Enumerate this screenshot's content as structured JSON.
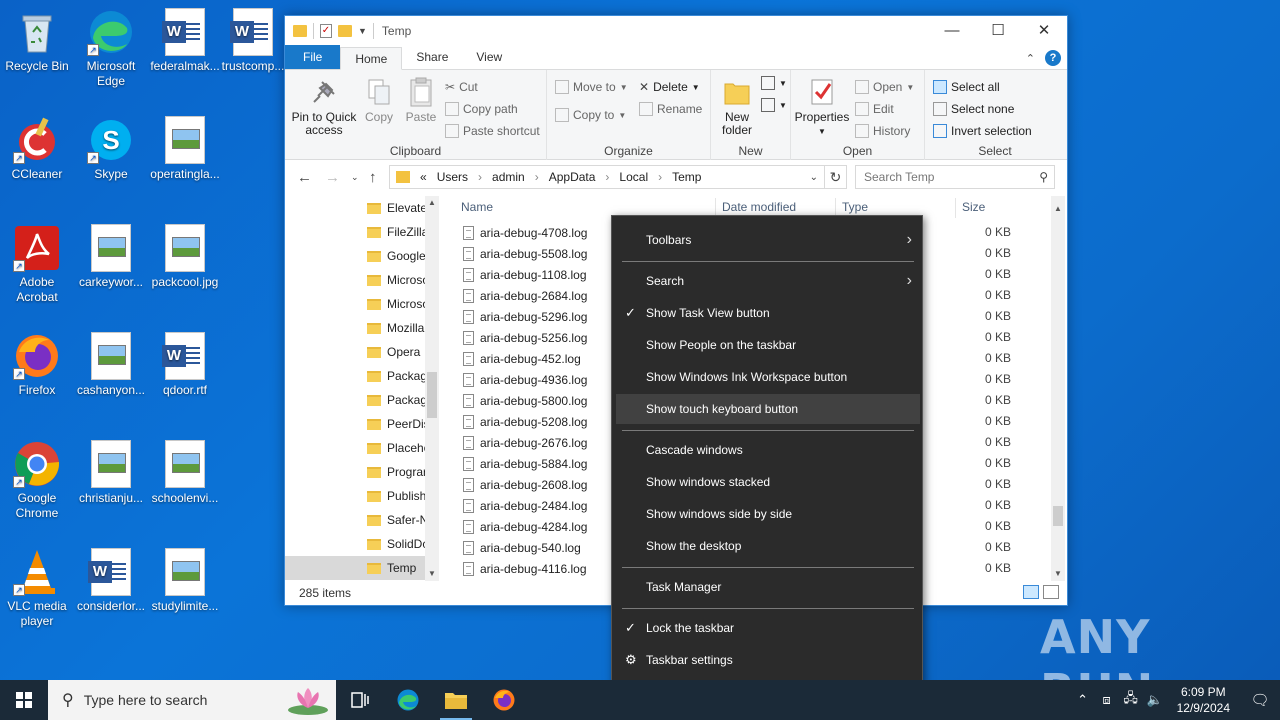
{
  "desktop": {
    "icons": [
      {
        "label": "Recycle Bin"
      },
      {
        "label": "Microsoft Edge"
      },
      {
        "label": "federalmak..."
      },
      {
        "label": "trustcomp..."
      },
      {
        "label": "CCleaner"
      },
      {
        "label": "Skype"
      },
      {
        "label": "operatingla..."
      },
      {
        "label": "Adobe Acrobat"
      },
      {
        "label": "carkeywor..."
      },
      {
        "label": "packcool.jpg"
      },
      {
        "label": "Firefox"
      },
      {
        "label": "cashanyon..."
      },
      {
        "label": "qdoor.rtf"
      },
      {
        "label": "Google Chrome"
      },
      {
        "label": "christianju..."
      },
      {
        "label": "schoolenvi..."
      },
      {
        "label": "VLC media player"
      },
      {
        "label": "considerlor..."
      },
      {
        "label": "studylimite..."
      }
    ]
  },
  "explorer": {
    "title": "Temp",
    "window_controls": {
      "minimize": "—",
      "maximize": "☐",
      "close": "✕"
    },
    "tabs": {
      "file": "File",
      "home": "Home",
      "share": "Share",
      "view": "View"
    },
    "ribbon": {
      "clipboard": {
        "label": "Clipboard",
        "pin": "Pin to Quick access",
        "copy": "Copy",
        "paste": "Paste",
        "cut": "Cut",
        "copy_path": "Copy path",
        "paste_shortcut": "Paste shortcut"
      },
      "organize": {
        "label": "Organize",
        "move_to": "Move to",
        "copy_to": "Copy to",
        "delete": "Delete",
        "rename": "Rename"
      },
      "new": {
        "label": "New",
        "new_folder": "New folder"
      },
      "open": {
        "label": "Open",
        "properties": "Properties",
        "open": "Open",
        "edit": "Edit",
        "history": "History"
      },
      "select": {
        "label": "Select",
        "select_all": "Select all",
        "select_none": "Select none",
        "invert": "Invert selection"
      }
    },
    "address": {
      "prefix": "«",
      "crumbs": [
        "Users",
        "admin",
        "AppData",
        "Local",
        "Temp"
      ],
      "search_placeholder": "Search Temp"
    },
    "nav_items": [
      {
        "label": "Elevate"
      },
      {
        "label": "FileZilla"
      },
      {
        "label": "Google"
      },
      {
        "label": "Microso"
      },
      {
        "label": "Microso"
      },
      {
        "label": "Mozilla"
      },
      {
        "label": "Opera"
      },
      {
        "label": "Packag"
      },
      {
        "label": "Packag"
      },
      {
        "label": "PeerDis"
      },
      {
        "label": "Placeho"
      },
      {
        "label": "Prograr"
      },
      {
        "label": "Publish"
      },
      {
        "label": "Safer-N"
      },
      {
        "label": "SolidDc"
      },
      {
        "label": "Temp"
      }
    ],
    "columns": {
      "name": "Name",
      "date": "Date modified",
      "type": "Type",
      "size": "Size"
    },
    "files": [
      {
        "name": "aria-debug-4708.log",
        "size": "0 KB"
      },
      {
        "name": "aria-debug-5508.log",
        "size": "0 KB"
      },
      {
        "name": "aria-debug-1108.log",
        "size": "0 KB"
      },
      {
        "name": "aria-debug-2684.log",
        "size": "0 KB"
      },
      {
        "name": "aria-debug-5296.log",
        "size": "0 KB"
      },
      {
        "name": "aria-debug-5256.log",
        "size": "0 KB"
      },
      {
        "name": "aria-debug-452.log",
        "size": "0 KB"
      },
      {
        "name": "aria-debug-4936.log",
        "size": "0 KB"
      },
      {
        "name": "aria-debug-5800.log",
        "size": "0 KB"
      },
      {
        "name": "aria-debug-5208.log",
        "size": "0 KB"
      },
      {
        "name": "aria-debug-2676.log",
        "size": "0 KB"
      },
      {
        "name": "aria-debug-5884.log",
        "size": "0 KB"
      },
      {
        "name": "aria-debug-2608.log",
        "size": "0 KB"
      },
      {
        "name": "aria-debug-2484.log",
        "size": "0 KB"
      },
      {
        "name": "aria-debug-4284.log",
        "size": "0 KB"
      },
      {
        "name": "aria-debug-540.log",
        "size": "0 KB"
      },
      {
        "name": "aria-debug-4116.log",
        "size": "0 KB"
      }
    ],
    "status": "285 items"
  },
  "context_menu": {
    "items": [
      {
        "label": "Toolbars",
        "submenu": true
      },
      {
        "label": "Search",
        "submenu": true
      },
      {
        "label": "Show Task View button",
        "checked": true
      },
      {
        "label": "Show People on the taskbar"
      },
      {
        "label": "Show Windows Ink Workspace button"
      },
      {
        "label": "Show touch keyboard button",
        "hover": true
      },
      {
        "label": "Cascade windows"
      },
      {
        "label": "Show windows stacked"
      },
      {
        "label": "Show windows side by side"
      },
      {
        "label": "Show the desktop"
      },
      {
        "label": "Task Manager"
      },
      {
        "label": "Lock the taskbar",
        "checked": true
      },
      {
        "label": "Taskbar settings",
        "gear": true
      }
    ]
  },
  "taskbar": {
    "search_placeholder": "Type here to search",
    "time": "6:09 PM",
    "date": "12/9/2024"
  },
  "watermark": "ANY RUN",
  "colors": {
    "accent": "#1979ca",
    "taskbar": "#1b2a38",
    "menu_bg": "#2b2b2b",
    "menu_hover": "#414141"
  }
}
